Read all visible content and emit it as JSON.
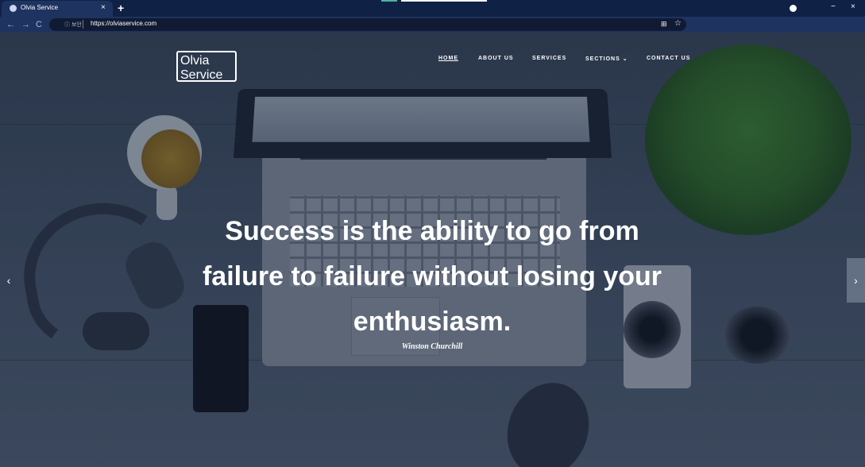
{
  "browser": {
    "tab": {
      "title": "Olvia Service",
      "close_glyph": "×"
    },
    "new_tab_glyph": "+",
    "toolbar": {
      "back_glyph": "←",
      "forward_glyph": "→",
      "reload_glyph": "C",
      "security_label": "ⓘ 보안",
      "url": "https://olviaservice.com",
      "translate_glyph": "⊞",
      "star_glyph": "☆"
    },
    "window_controls": {
      "minimize_glyph": "−",
      "close_glyph": "×"
    }
  },
  "site": {
    "logo_line1": "Olvia",
    "logo_line2": "Service",
    "nav": {
      "home": "HOME",
      "about": "ABOUT US",
      "services": "SERVICES",
      "sections": "SECTIONS ⌄",
      "contact": "CONTACT US"
    },
    "hero": {
      "quote_line1": "Success is the ability to go from",
      "quote_line2": "failure to failure without losing your",
      "quote_line3": "enthusiasm.",
      "author": "Winston Churchill"
    },
    "carousel": {
      "prev_glyph": "‹",
      "next_glyph": "›"
    }
  },
  "colors": {
    "tab_bar": "#0f2145",
    "toolbar": "#1e3360",
    "text": "#ffffff"
  },
  "icons": [
    "globe-favicon-icon",
    "info-icon",
    "translate-icon",
    "star-icon",
    "profile-icon",
    "chevron-left-icon",
    "chevron-right-icon"
  ]
}
